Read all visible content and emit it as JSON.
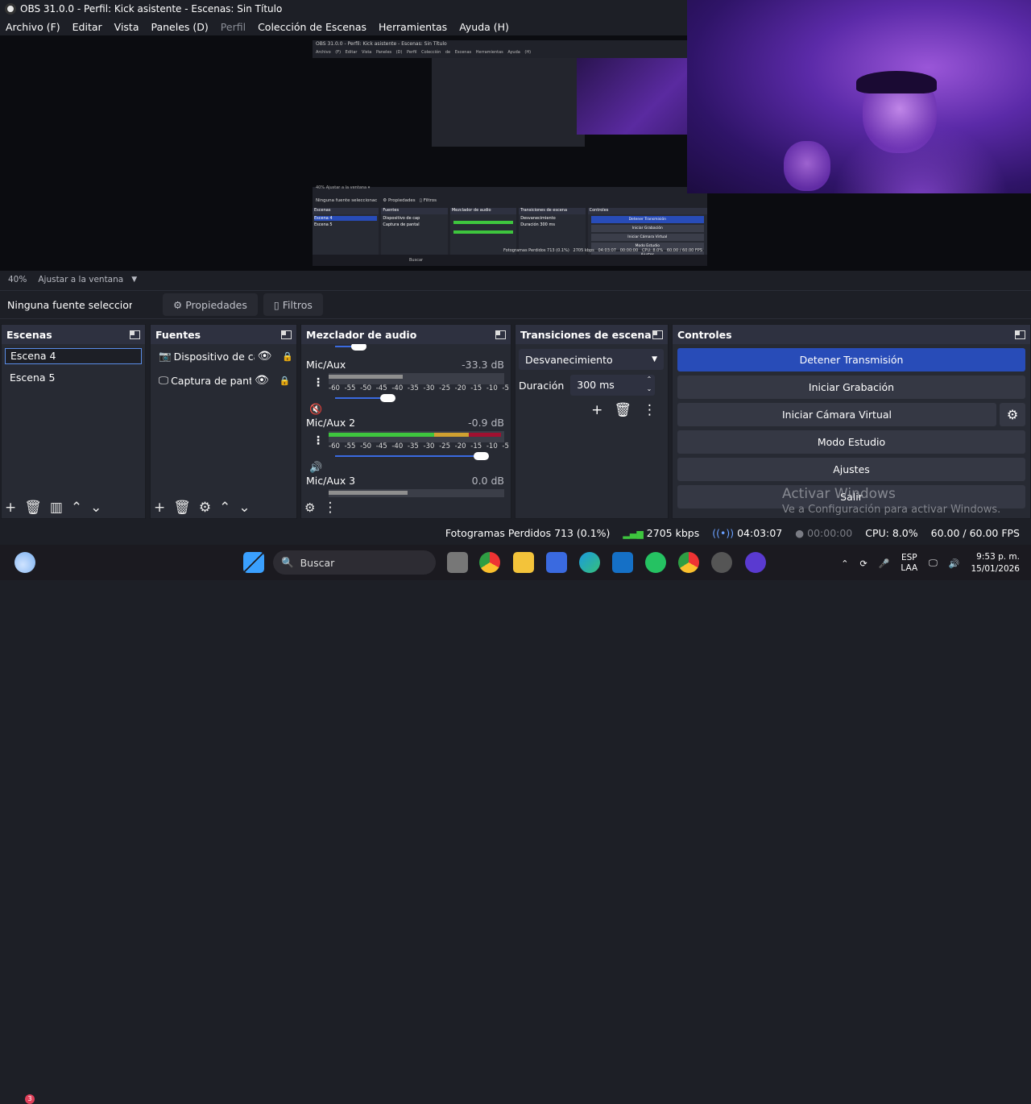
{
  "window": {
    "title": "OBS 31.0.0 - Perfil: Kick asistente - Escenas: Sin Título"
  },
  "menu": [
    {
      "label": "Archivo (F)",
      "enabled": true
    },
    {
      "label": "Editar",
      "enabled": true
    },
    {
      "label": "Vista",
      "enabled": true
    },
    {
      "label": "Paneles (D)",
      "enabled": true
    },
    {
      "label": "Perfil",
      "enabled": false
    },
    {
      "label": "Colección de Escenas",
      "enabled": true
    },
    {
      "label": "Herramientas",
      "enabled": true
    },
    {
      "label": "Ayuda (H)",
      "enabled": true
    }
  ],
  "zoom": {
    "level": "40%",
    "fit": "Ajustar a la ventana"
  },
  "props": {
    "no_source": "Ninguna fuente seleccionac",
    "properties": "Propiedades",
    "filters": "Filtros"
  },
  "scenes": {
    "title": "Escenas",
    "items": [
      "Escena 4",
      "Escena 5"
    ],
    "selected": "Escena 4"
  },
  "sources": {
    "title": "Fuentes",
    "items": [
      "Dispositivo de cap",
      "Captura de pantal"
    ]
  },
  "mixer": {
    "title": "Mezclador de audio",
    "ticks": "-60 -55 -50 -45 -40 -35 -30 -25 -20 -15 -10 -5 0",
    "channels": [
      {
        "name": "Mic/Aux",
        "db": "-33.3 dB",
        "level_fraction": 0.42,
        "volume_fraction": 0.37,
        "muted": true
      },
      {
        "name": "Mic/Aux 2",
        "db": "-0.9 dB",
        "level_fraction": 0.98,
        "volume_fraction": 1.0,
        "muted": false
      },
      {
        "name": "Mic/Aux 3",
        "db": "0.0 dB",
        "level_fraction": 0.45,
        "volume_fraction": 1.0,
        "muted": false
      }
    ]
  },
  "transitions": {
    "title": "Transiciones de escena",
    "selected": "Desvanecimiento",
    "duration_label": "Duración",
    "duration_value": "300 ms"
  },
  "controls": {
    "title": "Controles",
    "stop_stream": "Detener Transmisión",
    "start_record": "Iniciar Grabación",
    "start_vcam": "Iniciar Cámara Virtual",
    "studio_mode": "Modo Estudio",
    "settings": "Ajustes",
    "exit": "Salir"
  },
  "watermark": {
    "line1": "Activar Windows",
    "line2": "Ve a Configuración para activar Windows."
  },
  "status": {
    "dropped": "Fotogramas Perdidos 713 (0.1%)",
    "bitrate": "2705 kbps",
    "stream_time": "04:03:07",
    "record_time": "00:00:00",
    "cpu": "CPU: 8.0%",
    "fps": "60.00 / 60.00 FPS"
  },
  "taskbar": {
    "search": "Buscar",
    "weather_badge": "3",
    "lang": "ESP",
    "layout": "LAA",
    "time": "9:53 p. m.",
    "date": "15/01/2026"
  },
  "colors": {
    "accent": "#284cb8",
    "panel": "#272a33",
    "bg": "#1d1f26",
    "meter_green": "#3ec53e",
    "meter_red": "#a01030"
  }
}
